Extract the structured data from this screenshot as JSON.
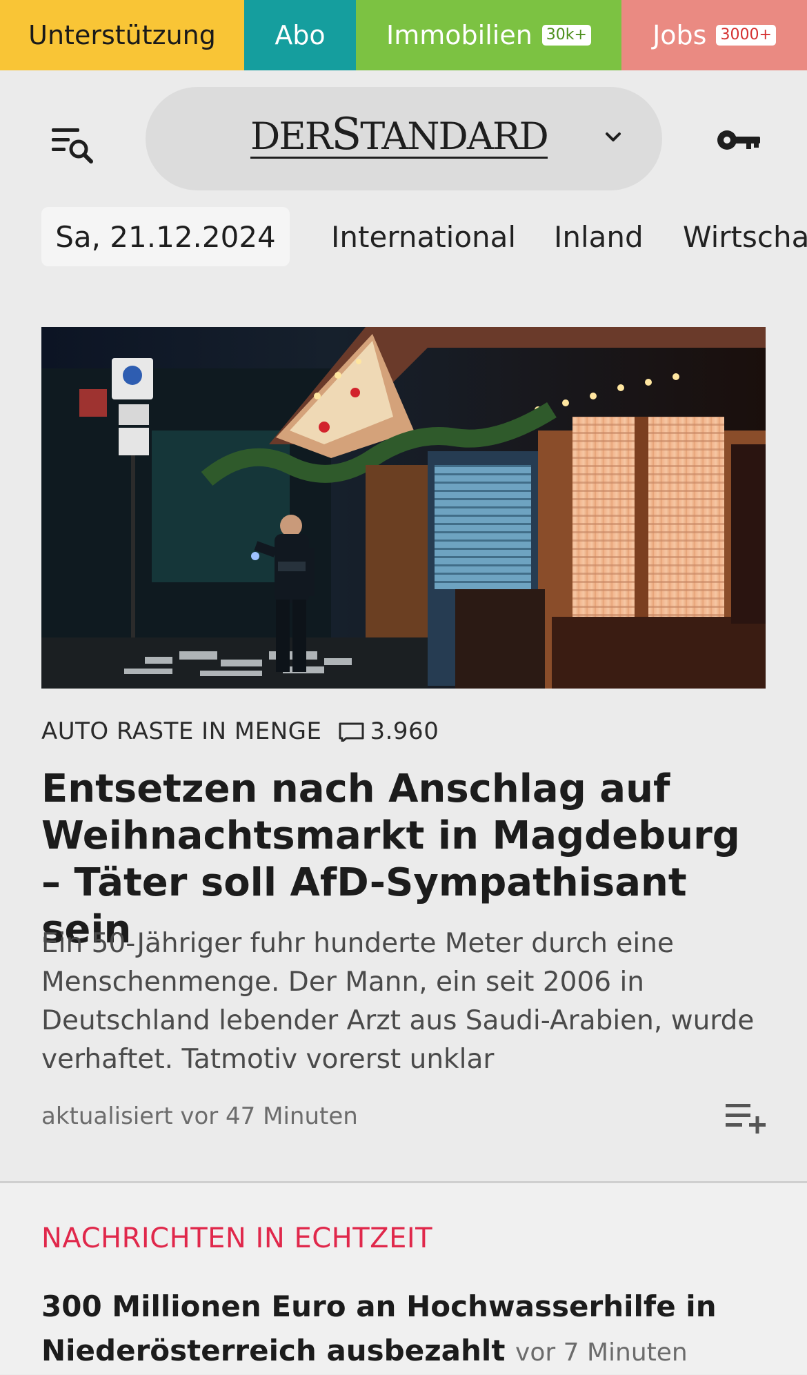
{
  "topbar": {
    "items": [
      {
        "label": "Unterstützung",
        "badge": ""
      },
      {
        "label": "Abo",
        "badge": ""
      },
      {
        "label": "Immobilien",
        "badge": "30k+"
      },
      {
        "label": "Jobs",
        "badge": "3000+"
      }
    ],
    "colors": [
      "#f9c536",
      "#159e9e",
      "#7cc242",
      "#ea8a82"
    ]
  },
  "header": {
    "logo_part1": "DER",
    "logo_part2": "S",
    "logo_part3": "TANDARD",
    "menu_icon": "menu-search-icon",
    "chevron_icon": "chevron-down-icon",
    "login_icon": "key-icon"
  },
  "nav": {
    "date": "Sa, 21.12.2024",
    "items": [
      "International",
      "Inland",
      "Wirtschaft"
    ]
  },
  "lead": {
    "kicker": "AUTO RASTE IN MENGE",
    "comment_count": "3.960",
    "headline": "Entsetzen nach Anschlag auf Weih­nachtsmarkt in Magdeburg – Täter soll AfD-Sympathisant sein",
    "teaser": "Ein 50-Jähriger fuhr hunderte Meter durch eine Menschenmenge. Der Mann, ein seit 2006 in Deutschland lebender Arzt aus Saudi-Arabien, wurde verhaftet. Tatmotiv vorerst unklar",
    "updated": "aktualisiert vor 47 Minuten"
  },
  "realtime": {
    "title": "NACHRICHTEN IN ECHTZEIT",
    "items": [
      {
        "headline": "300 Millionen Euro an Hochwasserhilfe in Nie­derösterreich ausbezahlt",
        "time": "vor 7 Minuten"
      }
    ],
    "accent": "#e0284b"
  }
}
